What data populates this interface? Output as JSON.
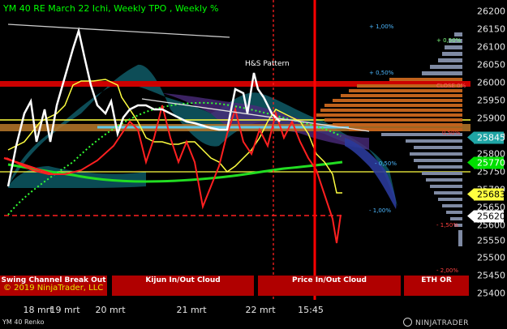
{
  "title": "YM 40 RE March 22 Ichi, Weekly TPO , Weekly %",
  "pane_title": "YM 40 Renko",
  "copyright": "© 2019 NinjaTrader, LLC",
  "annotation": "H&S Pattern",
  "logo_text": "NINJATRADER",
  "colors": {
    "background": "#000000",
    "title": "#00ff00",
    "bar_red": "#b00000",
    "price_line": "#ff0000",
    "tpo_orange": "#c0621c",
    "tpo_slate": "#7f8aa3"
  },
  "y_axis": {
    "ticks": [
      "26200",
      "26150",
      "26100",
      "26050",
      "26000",
      "25950",
      "25900",
      "25850",
      "25800",
      "25750",
      "25700",
      "25650",
      "25600",
      "25550",
      "25500",
      "25450",
      "25400"
    ]
  },
  "x_axis": {
    "labels": [
      "18 mrt",
      "19 mrt",
      "20 mrt",
      "21 mrt",
      "22 mrt",
      "15:45"
    ]
  },
  "price_tags": [
    {
      "value": "25845",
      "bg": "#1fa5a5",
      "fg": "#ffffff"
    },
    {
      "value": "25770",
      "bg": "#00e000",
      "fg": "#ffffff"
    },
    {
      "value": "25683",
      "bg": "#ffff40",
      "fg": "#000000"
    },
    {
      "value": "25620",
      "bg": "#ffffff",
      "fg": "#000000"
    }
  ],
  "percent_labels": [
    {
      "text": "+ 1,00%",
      "color": "#4db8ff"
    },
    {
      "text": "+ 0,50%",
      "color": "#80ff80"
    },
    {
      "text": "+ 0,50%",
      "color": "#4db8ff"
    },
    {
      "text": "CLOSE 0%",
      "color": "#ff6060"
    },
    {
      "text": "0,50%",
      "color": "#ff4040"
    },
    {
      "text": "- 0,50%",
      "color": "#4db8ff"
    },
    {
      "text": "- 1,00%",
      "color": "#4db8ff"
    },
    {
      "text": "- 1,50%",
      "color": "#ff4040"
    },
    {
      "text": "- 2,00%",
      "color": "#ff4040"
    }
  ],
  "bottom_bars": [
    {
      "l1": "Swing Channel Break Out",
      "l2": ""
    },
    {
      "l1": "Kijun In/Out Cloud",
      "l2": ""
    },
    {
      "l1": "Price In/Out Cloud",
      "l2": ""
    },
    {
      "l1": "ETH OR",
      "l2": ""
    }
  ]
}
